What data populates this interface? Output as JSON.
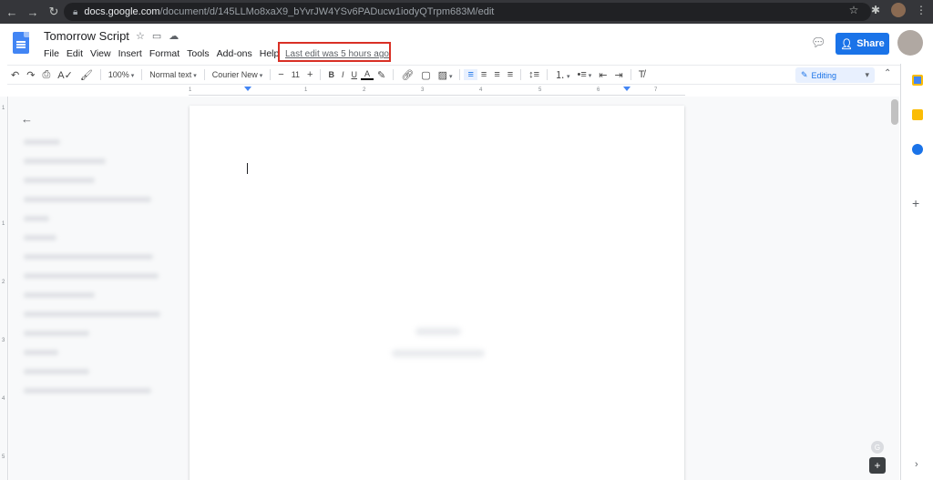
{
  "browser": {
    "url_host": "docs.google.com",
    "url_path": "/document/d/145LLMo8xaX9_bYvrJW4YSv6PADucw1iodyQTrpm683M/edit"
  },
  "doc": {
    "title": "Tomorrow Script",
    "menu": [
      "File",
      "Edit",
      "View",
      "Insert",
      "Format",
      "Tools",
      "Add-ons",
      "Help"
    ],
    "last_edit": "Last edit was 5 hours ago",
    "share_label": "Share"
  },
  "toolbar": {
    "zoom": "100%",
    "style": "Normal text",
    "font": "Courier New",
    "font_size": "11",
    "bold": "B",
    "italic": "I",
    "underline": "U",
    "text_color": "A",
    "mode": "Editing"
  },
  "ruler": {
    "numbers": [
      "1",
      "1",
      "2",
      "3",
      "4",
      "5",
      "6",
      "7"
    ]
  },
  "vruler": {
    "numbers": [
      "1",
      "1",
      "2",
      "3",
      "4",
      "5"
    ]
  },
  "colors": {
    "accent": "#1a73e8",
    "highlight": "#d93025"
  }
}
